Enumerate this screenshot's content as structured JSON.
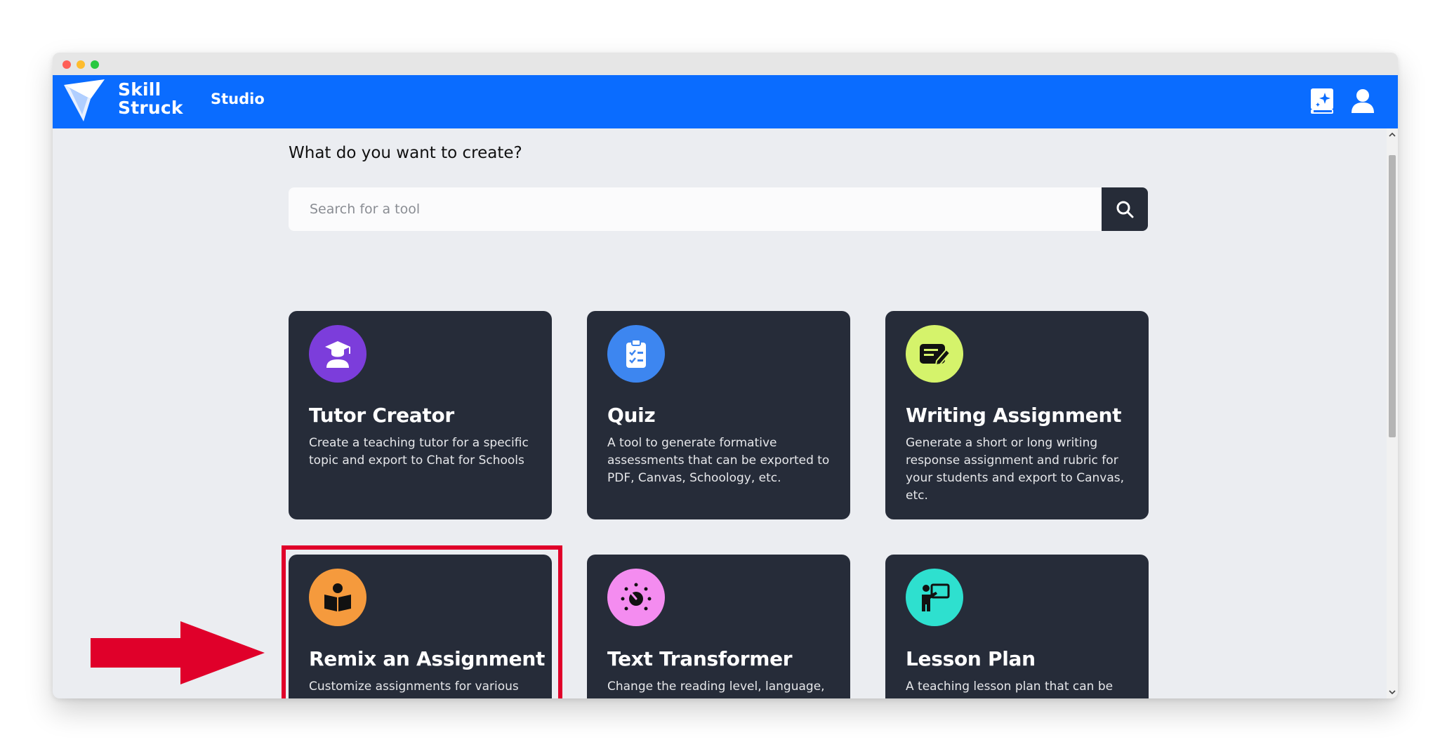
{
  "app": {
    "brand_line1": "Skill",
    "brand_line2": "Struck",
    "nav_label": "Studio"
  },
  "main": {
    "heading": "What do you want to create?",
    "search_placeholder": "Search for a tool"
  },
  "cards": [
    {
      "title": "Tutor Creator",
      "description": "Create a teaching tutor for a specific topic and export to Chat for Schools",
      "icon": "graduate-icon",
      "color": "#7c3ddb"
    },
    {
      "title": "Quiz",
      "description": "A tool to generate formative assessments that can be exported to PDF, Canvas, Schoology, etc.",
      "icon": "clipboard-check-icon",
      "color": "#3d86f0"
    },
    {
      "title": "Writing Assignment",
      "description": "Generate a short or long writing response assignment and rubric for your students and export to Canvas, etc.",
      "icon": "pen-note-icon",
      "color": "#d5f36b"
    },
    {
      "title": "Remix an Assignment",
      "description": "Customize assignments for various learning styles and export to Canvas, etc.",
      "icon": "reader-icon",
      "color": "#f59a3d"
    },
    {
      "title": "Text Transformer",
      "description": "Change the reading level, language, and more for text that you can copy.",
      "icon": "sparkle-dial-icon",
      "color": "#f48cf0"
    },
    {
      "title": "Lesson Plan",
      "description": "A teaching lesson plan that can be exported to PDF",
      "icon": "teacher-board-icon",
      "color": "#2ee0cf"
    }
  ],
  "colors": {
    "appbar": "#0a6cff",
    "card_bg": "#262c39",
    "highlight": "#e0002a"
  }
}
